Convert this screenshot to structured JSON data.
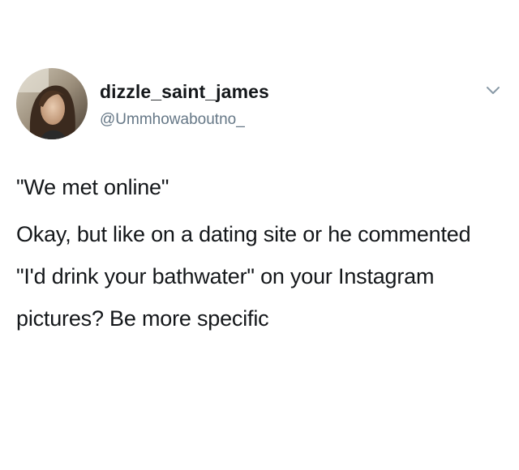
{
  "tweet": {
    "display_name": "dizzle_saint_james",
    "handle": "@Ummhowaboutno_",
    "paragraphs": [
      "\"We met online\"",
      "Okay, but like on a dating site or he commented \"I'd drink your bathwater\" on your Instagram pictures? Be more specific"
    ]
  },
  "icons": {
    "avatar": "profile-photo",
    "menu": "chevron-down-icon"
  },
  "colors": {
    "text": "#14171a",
    "secondary_text": "#657786",
    "chevron": "#8899a6",
    "background": "#ffffff"
  }
}
